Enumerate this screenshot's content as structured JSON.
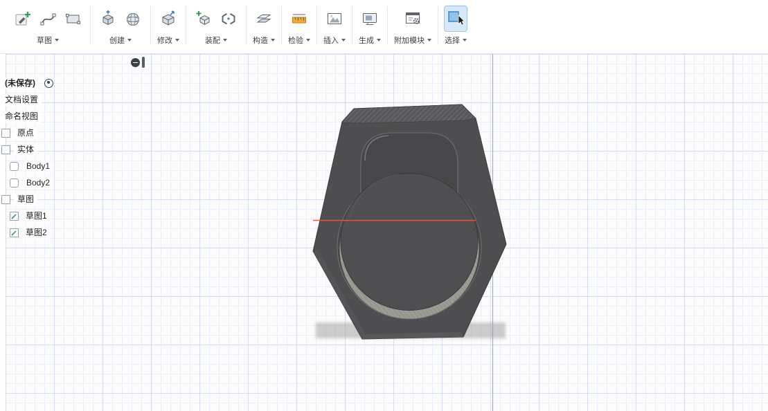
{
  "toolbar": {
    "groups": [
      {
        "label": "草图",
        "active": false,
        "icons": [
          "create-sketch-icon",
          "spline-icon",
          "two-point-rectangle-icon"
        ]
      },
      {
        "label": "创建",
        "active": false,
        "icons": [
          "extrude-icon",
          "create-form-icon"
        ]
      },
      {
        "label": "修改",
        "active": false,
        "icons": [
          "press-pull-icon"
        ]
      },
      {
        "label": "装配",
        "active": false,
        "icons": [
          "new-component-icon",
          "joint-icon"
        ]
      },
      {
        "label": "构造",
        "active": false,
        "icons": [
          "construction-plane-icon"
        ]
      },
      {
        "label": "检验",
        "active": false,
        "icons": [
          "measure-icon"
        ]
      },
      {
        "label": "插入",
        "active": false,
        "icons": [
          "insert-canvas-icon"
        ]
      },
      {
        "label": "生成",
        "active": false,
        "icons": [
          "make-icon"
        ]
      },
      {
        "label": "附加模块",
        "active": false,
        "icons": [
          "scripts-addins-icon"
        ]
      },
      {
        "label": "选择",
        "active": true,
        "icons": [
          "select-window-icon",
          "cursor-icon"
        ]
      }
    ]
  },
  "browser": {
    "document_title": "(未保存)",
    "items": [
      {
        "label": "文档设置",
        "icon": null
      },
      {
        "label": "命名视图",
        "icon": null
      },
      {
        "label": "原点",
        "icon": "collection-icon"
      },
      {
        "label": "实体",
        "icon": "collection-icon"
      },
      {
        "label": "Body1",
        "icon": "body-icon"
      },
      {
        "label": "Body2",
        "icon": "body-icon"
      },
      {
        "label": "草图",
        "icon": "collection-icon"
      },
      {
        "label": "草图1",
        "icon": "sketch-icon"
      },
      {
        "label": "草图2",
        "icon": "sketch-icon"
      }
    ]
  },
  "viewport": {
    "x_axis_color": "#d2604c",
    "z_axis_color": "#8aa7d9",
    "model_color": "#4e4e51",
    "pocket_color": "#47474a",
    "boss_color": "#4f4f52",
    "rim_highlight_color": "#97978f",
    "shadow_color": "#9e9e9e",
    "grid_major_color": "#c6d1e0",
    "grid_minor_color": "#d5dde9",
    "select_highlight_color": "#8cc0ea"
  }
}
